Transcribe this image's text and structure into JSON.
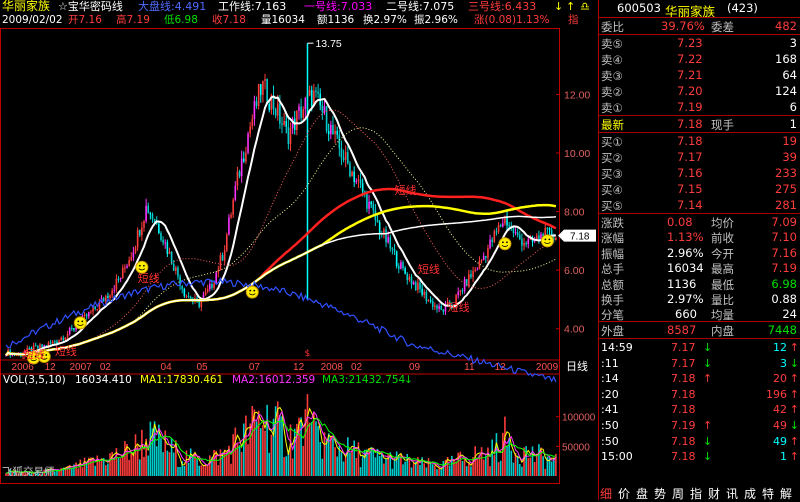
{
  "colors": {
    "background": "#000000",
    "up": "#ff3c3c",
    "down": "#00e000",
    "grid": "#a00000",
    "axis": "#c00000",
    "accent_yellow": "#ffff00",
    "cyan": "#00ffff",
    "magenta": "#ff33ff"
  },
  "title_bar": {
    "stock_name": "华丽家族",
    "indicator_name": "☆宝华密码线",
    "lines": [
      {
        "label": "大盘线:4.491",
        "color": "#4f6bff"
      },
      {
        "label": "工作线:7.163",
        "color": "#ffffff"
      },
      {
        "label": "一号线:7.033",
        "color": "#ff00ff"
      },
      {
        "label": "二号线:7.075",
        "color": "#ffffff"
      },
      {
        "label": "三号线:6.433",
        "color": "#ff3c3c"
      }
    ],
    "toolbar_icons": [
      "arrow-down-icon",
      "arrow-up-icon",
      "bell-icon"
    ]
  },
  "info_bar": {
    "date": "2009/02/02",
    "open": "开7.16",
    "high": "高7.19",
    "low": "低6.98",
    "close": "收7.18",
    "volume": "量16034",
    "amount": "额1136",
    "turnover": "换2.97%",
    "amplitude": "振2.96%",
    "change": "涨(0.08)1.13%",
    "more": "指"
  },
  "main_chart": {
    "y_ticks": [
      "12.00",
      "10.00",
      "8.00",
      "6.00",
      "4.00"
    ],
    "y_tick_values": [
      12,
      10,
      8,
      6,
      4
    ],
    "price_range": [
      3.0,
      14.2
    ],
    "max_label": "13.75",
    "current_price_tag": "7.18",
    "annotations": [
      "短线",
      "短线",
      "短线",
      "短线",
      "短线",
      "短线"
    ],
    "smiley_count": 7,
    "x_labels": [
      "2006",
      "12",
      "2007",
      "02",
      "04",
      "05",
      "07",
      "12",
      "2008",
      "02",
      "09",
      "11",
      "12",
      "2009"
    ],
    "period_label": "日线"
  },
  "volume_chart": {
    "header": {
      "vol": "VOL(3,5,10)",
      "vol_value": "16034.410",
      "ma1": "MA1:17830.461",
      "ma2": "MA2:16012.359",
      "ma3": "MA3:21432.754"
    },
    "y_ticks": [
      "100000",
      "50000"
    ],
    "y_tick_values": [
      100000,
      50000
    ],
    "vol_max": 145000,
    "watermark": "飞狐交易师"
  },
  "chart_data": [
    {
      "type": "candlestick",
      "title": "",
      "series_lines": [
        "大盘线",
        "工作线",
        "一号线",
        "二号线",
        "三号线"
      ],
      "ylim": [
        3.0,
        14.2
      ],
      "x_labels": [
        "2006",
        "12",
        "2007",
        "02",
        "04",
        "05",
        "07",
        "12",
        "2008",
        "02",
        "09",
        "11",
        "12",
        "2009"
      ],
      "key_values": {
        "high_marker": 13.75,
        "last_close": 7.18,
        "last_open": 7.16,
        "last_high": 7.19,
        "last_low": 6.98
      },
      "price_path": [
        3.2,
        3.1,
        3.3,
        3.4,
        3.6,
        3.9,
        4.3,
        4.7,
        5.2,
        5.8,
        6.8,
        8.2,
        7.4,
        6.3,
        5.2,
        4.8,
        5.4,
        6.6,
        8.9,
        10.8,
        12.3,
        11.6,
        10.6,
        11.4,
        12.0,
        11.2,
        10.2,
        9.4,
        8.6,
        7.6,
        6.8,
        6.0,
        5.5,
        5.0,
        4.6,
        4.9,
        5.6,
        6.2,
        7.0,
        7.8,
        7.1,
        6.9,
        7.2,
        7.18
      ]
    },
    {
      "type": "bar",
      "title": "",
      "ylim": [
        0,
        145000
      ],
      "profile": [
        8,
        6,
        5,
        7,
        9,
        12,
        18,
        22,
        30,
        35,
        45,
        60,
        55,
        40,
        30,
        25,
        28,
        35,
        55,
        70,
        95,
        80,
        60,
        75,
        65,
        55,
        45,
        38,
        35,
        30,
        28,
        25,
        20,
        18,
        16,
        22,
        30,
        34,
        38,
        60,
        42,
        35,
        30,
        24
      ]
    }
  ],
  "right_panel": {
    "code": "600503",
    "name": "华丽家族",
    "count": "(423)",
    "wei_bi": {
      "label": "委比",
      "value": "39.76%",
      "label2": "委差",
      "value2": "482"
    },
    "asks": [
      {
        "label": "卖⑤",
        "price": "7.23",
        "vol": "3"
      },
      {
        "label": "卖④",
        "price": "7.22",
        "vol": "168"
      },
      {
        "label": "卖③",
        "price": "7.21",
        "vol": "64"
      },
      {
        "label": "卖②",
        "price": "7.20",
        "vol": "124"
      },
      {
        "label": "卖①",
        "price": "7.19",
        "vol": "6"
      }
    ],
    "latest": {
      "label": "最新",
      "price": "7.18",
      "label2": "现手",
      "value2": "1"
    },
    "bids": [
      {
        "label": "买①",
        "price": "7.18",
        "vol": "19"
      },
      {
        "label": "买②",
        "price": "7.17",
        "vol": "39"
      },
      {
        "label": "买③",
        "price": "7.16",
        "vol": "233"
      },
      {
        "label": "买④",
        "price": "7.15",
        "vol": "275"
      },
      {
        "label": "买⑤",
        "price": "7.14",
        "vol": "281"
      }
    ],
    "stats": [
      {
        "l1": "涨跌",
        "v1": "0.08",
        "l2": "均价",
        "v2": "7.09"
      },
      {
        "l1": "涨幅",
        "v1": "1.13%",
        "l2": "前收",
        "v2": "7.10"
      },
      {
        "l1": "振幅",
        "v1": "2.96%",
        "l2": "今开",
        "v2": "7.16"
      },
      {
        "l1": "总手",
        "v1": "16034",
        "l2": "最高",
        "v2": "7.19"
      },
      {
        "l1": "总额",
        "v1": "1136",
        "l2": "最低",
        "v2": "6.98"
      },
      {
        "l1": "换手",
        "v1": "2.97%",
        "l2": "量比",
        "v2": "0.88"
      },
      {
        "l1": "分笔",
        "v1": "660",
        "l2": "均量",
        "v2": "24"
      }
    ],
    "outer_inner": {
      "l1": "外盘",
      "v1": "8587",
      "l2": "内盘",
      "v2": "7448"
    },
    "ticks": [
      {
        "time": "14:59",
        "price": "7.17",
        "dir": "↓",
        "vol": "12"
      },
      {
        "time": ":11",
        "price": "7.17",
        "dir": "↓",
        "vol": "3"
      },
      {
        "time": ":14",
        "price": "7.18",
        "dir": "↑",
        "vol": "20"
      },
      {
        "time": ":20",
        "price": "7.18",
        "dir": "",
        "vol": "196"
      },
      {
        "time": ":41",
        "price": "7.18",
        "dir": "",
        "vol": "42"
      },
      {
        "time": ":50",
        "price": "7.19",
        "dir": "↑",
        "vol": "49"
      },
      {
        "time": ":50",
        "price": "7.18",
        "dir": "↓",
        "vol": "49"
      },
      {
        "time": "15:00",
        "price": "7.18",
        "dir": "↓",
        "vol": "1"
      }
    ],
    "bottom_tabs": [
      "细",
      "价",
      "盘",
      "势",
      "周",
      "指",
      "财",
      "讯",
      "成",
      "特",
      "解"
    ]
  }
}
